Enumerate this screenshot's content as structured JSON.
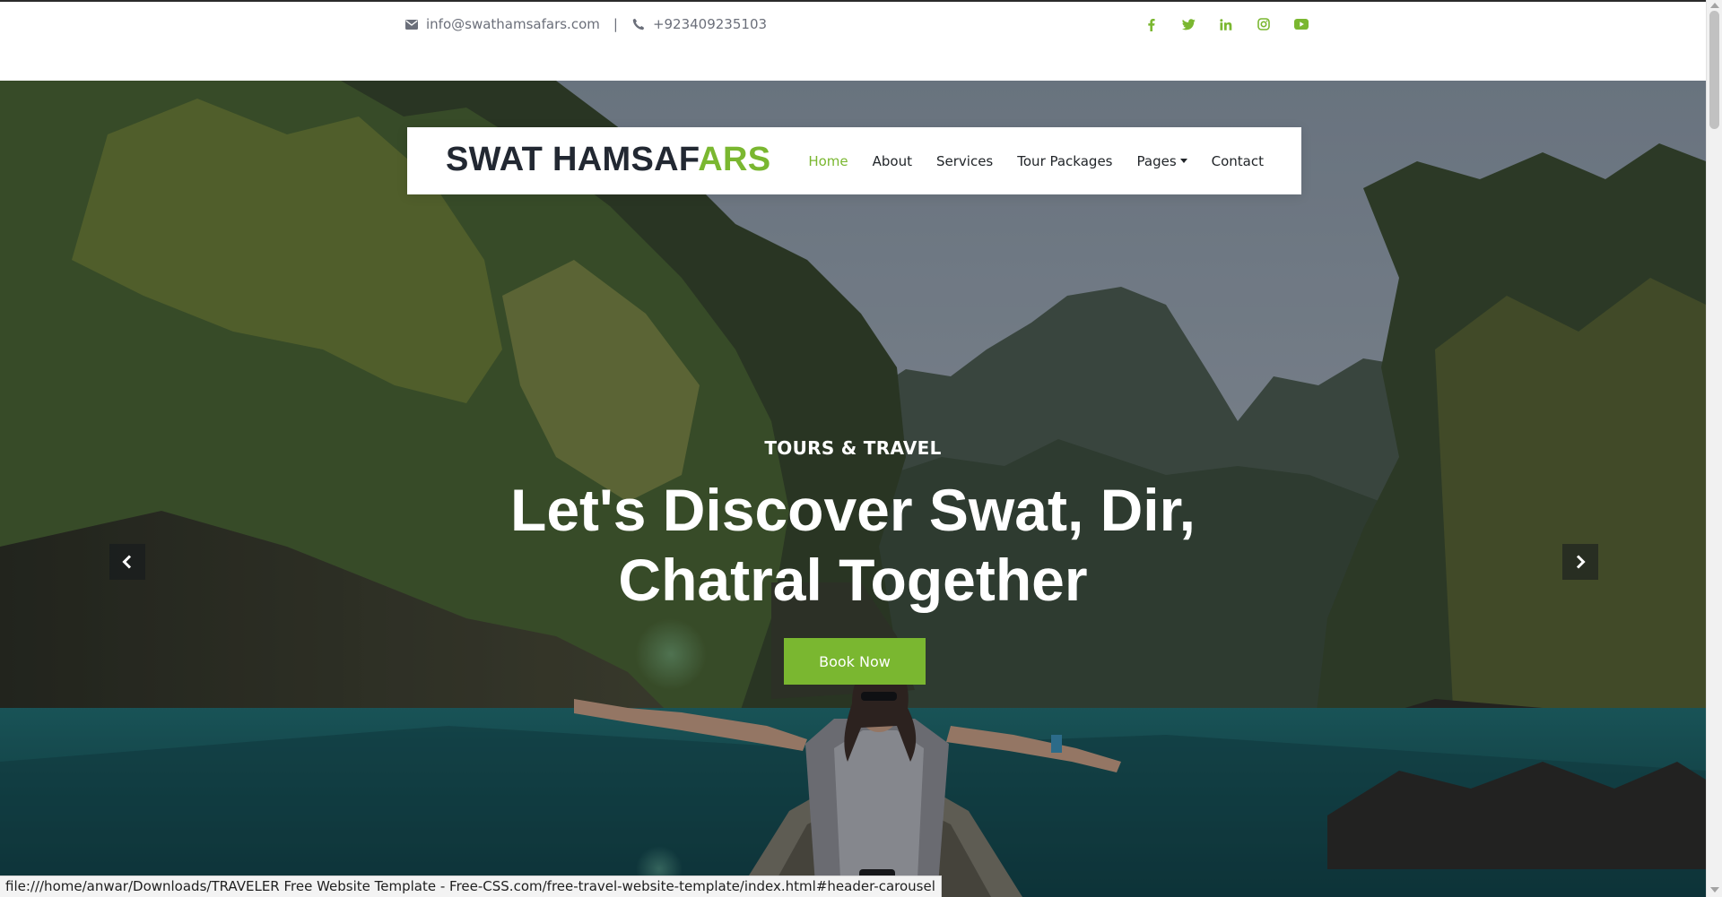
{
  "topbar": {
    "email": "info@swathamsafars.com",
    "separator": "|",
    "phone": "+923409235103",
    "social_icons": [
      "facebook-icon",
      "twitter-icon",
      "linkedin-icon",
      "instagram-icon",
      "youtube-icon"
    ]
  },
  "brand": {
    "part1": "SWAT HAMSAF",
    "part2": "ARS"
  },
  "nav": {
    "home": "Home",
    "about": "About",
    "services": "Services",
    "tour_packages": "Tour Packages",
    "pages": "Pages",
    "contact": "Contact",
    "active": "Home"
  },
  "hero": {
    "kicker": "TOURS & TRAVEL",
    "headline_line1": "Let's Discover Swat, Dir,",
    "headline_line2": "Chatral Together",
    "cta": "Book Now"
  },
  "status_url": "file:///home/anwar/Downloads/TRAVELER Free Website Template - Free-CSS.com/free-travel-website-template/index.html#header-carousel",
  "colors": {
    "accent": "#7ab730",
    "dark": "#222832",
    "muted": "#6b6f7a"
  }
}
